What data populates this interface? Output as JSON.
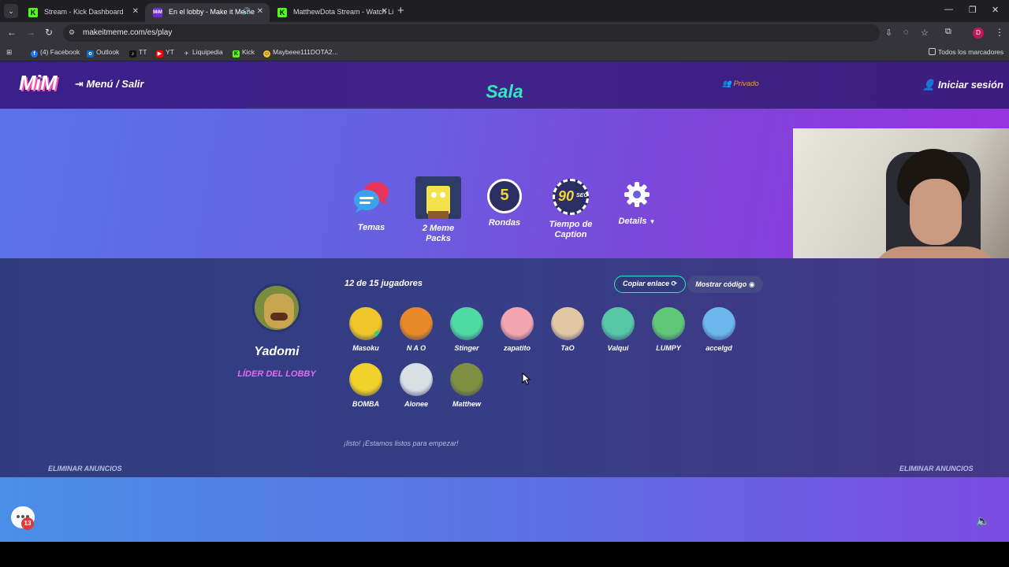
{
  "browser": {
    "tabs": [
      {
        "title": "Stream - Kick Dashboard",
        "favicon": "kick-icon",
        "active": false
      },
      {
        "title": "En el lobby - Make it Meme",
        "favicon": "mim-icon",
        "active": true
      },
      {
        "title": "MatthewDota Stream - Watch Li",
        "favicon": "kick-icon",
        "active": false
      }
    ],
    "url": "makeitmeme.com/es/play",
    "bookmarks": [
      {
        "label": "(4) Facebook",
        "icon": "facebook-icon",
        "color": "#1877f2"
      },
      {
        "label": "Outlook",
        "icon": "outlook-icon",
        "color": "#0f6cbd"
      },
      {
        "label": "TT",
        "icon": "tiktok-icon",
        "color": "#111111"
      },
      {
        "label": "YT",
        "icon": "youtube-icon",
        "color": "#ff0000"
      },
      {
        "label": "Liquipedia",
        "icon": "liquipedia-icon",
        "color": "#cccccc"
      },
      {
        "label": "Kick",
        "icon": "kick-icon",
        "color": "#53fc18"
      },
      {
        "label": "Maybeee111DOTA2...",
        "icon": "smiley-icon",
        "color": "#f2c230"
      }
    ],
    "all_bookmarks": "Todos los marcadores",
    "profile_initial": "D"
  },
  "header": {
    "logo": "MiM",
    "menu": "Menú / Salir",
    "title": "Sala",
    "privacy": "Privado",
    "login": "Iniciar sesión"
  },
  "settings": [
    {
      "label": "Temas",
      "icon": "chat-bubbles-icon"
    },
    {
      "label": "2 Meme Packs",
      "icon": "meme-pack-icon"
    },
    {
      "label": "Rondas",
      "icon": "rounds-icon",
      "value": "5"
    },
    {
      "label": "Tiempo de Caption",
      "icon": "timer-icon",
      "value": "90",
      "unit": "SEC"
    },
    {
      "label": "Details",
      "icon": "gear-icon"
    }
  ],
  "lobby": {
    "leader": {
      "name": "Yadomi",
      "role": "LÍDER DEL LOBBY"
    },
    "count_text": "12 de 15 jugadores",
    "copy_link": "Copiar enlace",
    "show_code": "Mostrar código",
    "players": [
      {
        "name": "Masoku",
        "color": "#f0c52a",
        "online": true
      },
      {
        "name": "N A O",
        "color": "#e88a2a"
      },
      {
        "name": "Stinger",
        "color": "#4fd9a3"
      },
      {
        "name": "zapatito",
        "color": "#f3a6b0"
      },
      {
        "name": "TaO",
        "color": "#e2c7a4"
      },
      {
        "name": "Valqui",
        "color": "#58c7a5"
      },
      {
        "name": "LUMPY",
        "color": "#5fc777"
      },
      {
        "name": "accelgd",
        "color": "#6bb8ee"
      },
      {
        "name": "BOMBA",
        "color": "#f2d12a"
      },
      {
        "name": "Alonee",
        "color": "#d8e0e6"
      },
      {
        "name": "Matthew",
        "color": "#7f8f41"
      }
    ],
    "ready_text": "¡listo! ¡Estamos listos para empezar!",
    "remove_ads": "ELIMINAR ANUNCIOS"
  },
  "footer": {
    "chat_badge": "13"
  }
}
